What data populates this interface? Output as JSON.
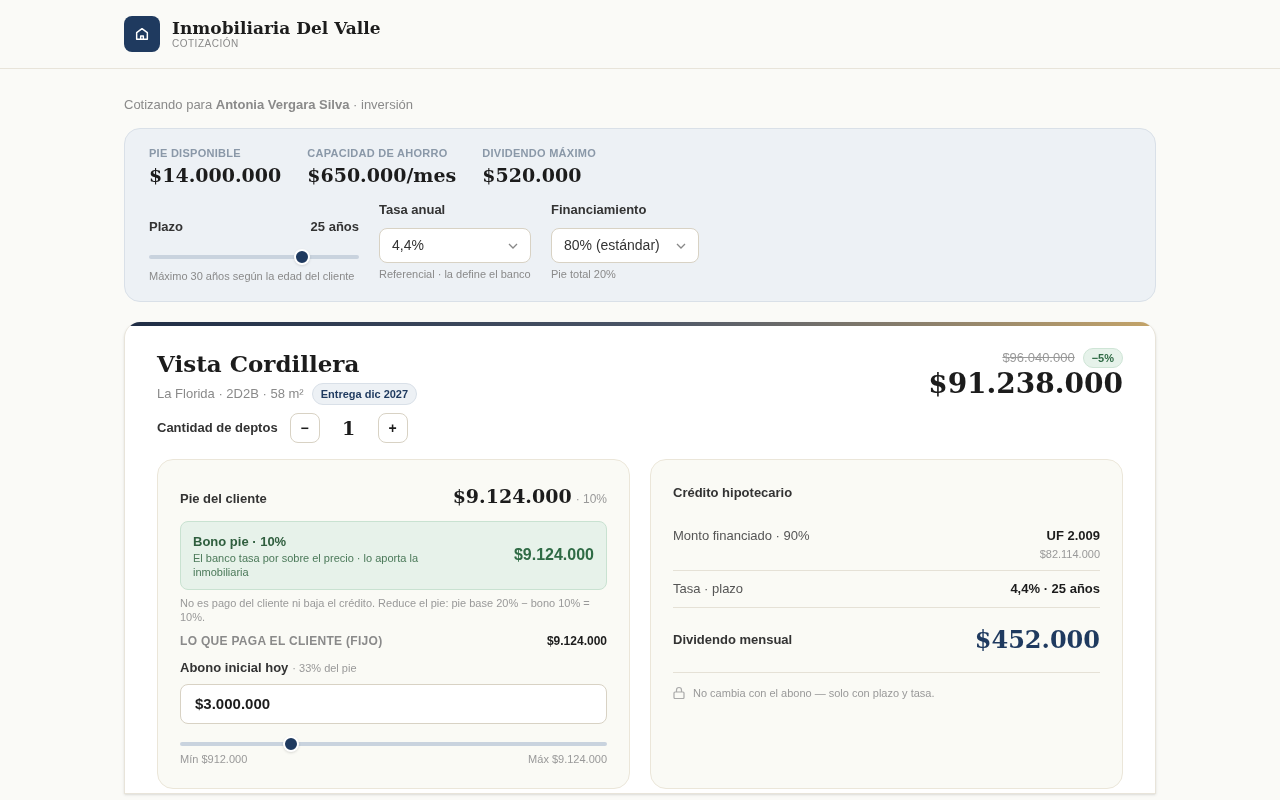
{
  "header": {
    "title": "Inmobiliaria Del Valle",
    "subtitle": "COTIZACIÓN"
  },
  "client_line": "Cotizando para **Antonia Vergara Silva** · inversión",
  "summary": {
    "stats": [
      {
        "label": "PIE DISPONIBLE",
        "value": "$14.000.000"
      },
      {
        "label": "CAPACIDAD DE AHORRO",
        "value": "$650.000/mes"
      },
      {
        "label": "DIVIDENDO MÁXIMO",
        "value": "$520.000"
      }
    ],
    "plazo": {
      "label": "Plazo",
      "reading": "25 años",
      "level": 0.73,
      "hint": "Máximo 30 años según la edad del cliente"
    },
    "selects": [
      {
        "label": "Tasa anual",
        "value": "4,4%",
        "hint": "Referencial · la define el banco"
      },
      {
        "label": "Financiamiento",
        "value": "80% (estándar)",
        "hint": "Pie total 20%"
      }
    ]
  },
  "project": {
    "name": "Vista Cordillera",
    "details": "La Florida · 2D2B · 58 m²",
    "badge": "Entrega dic 2027",
    "old_price": "$96.040.000",
    "discount": "−5%",
    "price": "$91.238.000",
    "quantity": {
      "label": "Cantidad de deptos",
      "minus": "−",
      "value": "1",
      "plus": "+"
    },
    "pie": {
      "title": "Pie del cliente",
      "amount": "$9.124.000",
      "percent": "· 10%",
      "bono": {
        "title": "Bono pie · 10%",
        "description": "El banco tasa por sobre el precio · lo aporta la inmobiliaria",
        "amount": "$9.124.000"
      },
      "note": "No es pago del cliente ni baja el crédito. Reduce el pie: pie base 20% − bono 10% = 10%.",
      "fixed_label": "LO QUE PAGA EL CLIENTE (FIJO)",
      "fixed_value": "$9.124.000",
      "abono_label": "Abono inicial hoy",
      "abono_hint": "· 33% del pie",
      "abono_value": "$3.000.000",
      "abono_slider": {
        "level": 0.26,
        "min": "Mín $912.000",
        "max": "Máx $9.124.000"
      }
    },
    "credit": {
      "title": "Crédito hipotecario",
      "rows": [
        {
          "label": "Monto financiado · 90%",
          "value": "UF 2.009",
          "subvalue": "$82.114.000"
        },
        {
          "label": "Tasa · plazo",
          "value": "4,4% · 25 años"
        }
      ],
      "dividend_label": "Dividendo mensual",
      "dividend_value": "$452.000",
      "note": "No cambia con el abono — solo con plazo y tasa."
    }
  }
}
